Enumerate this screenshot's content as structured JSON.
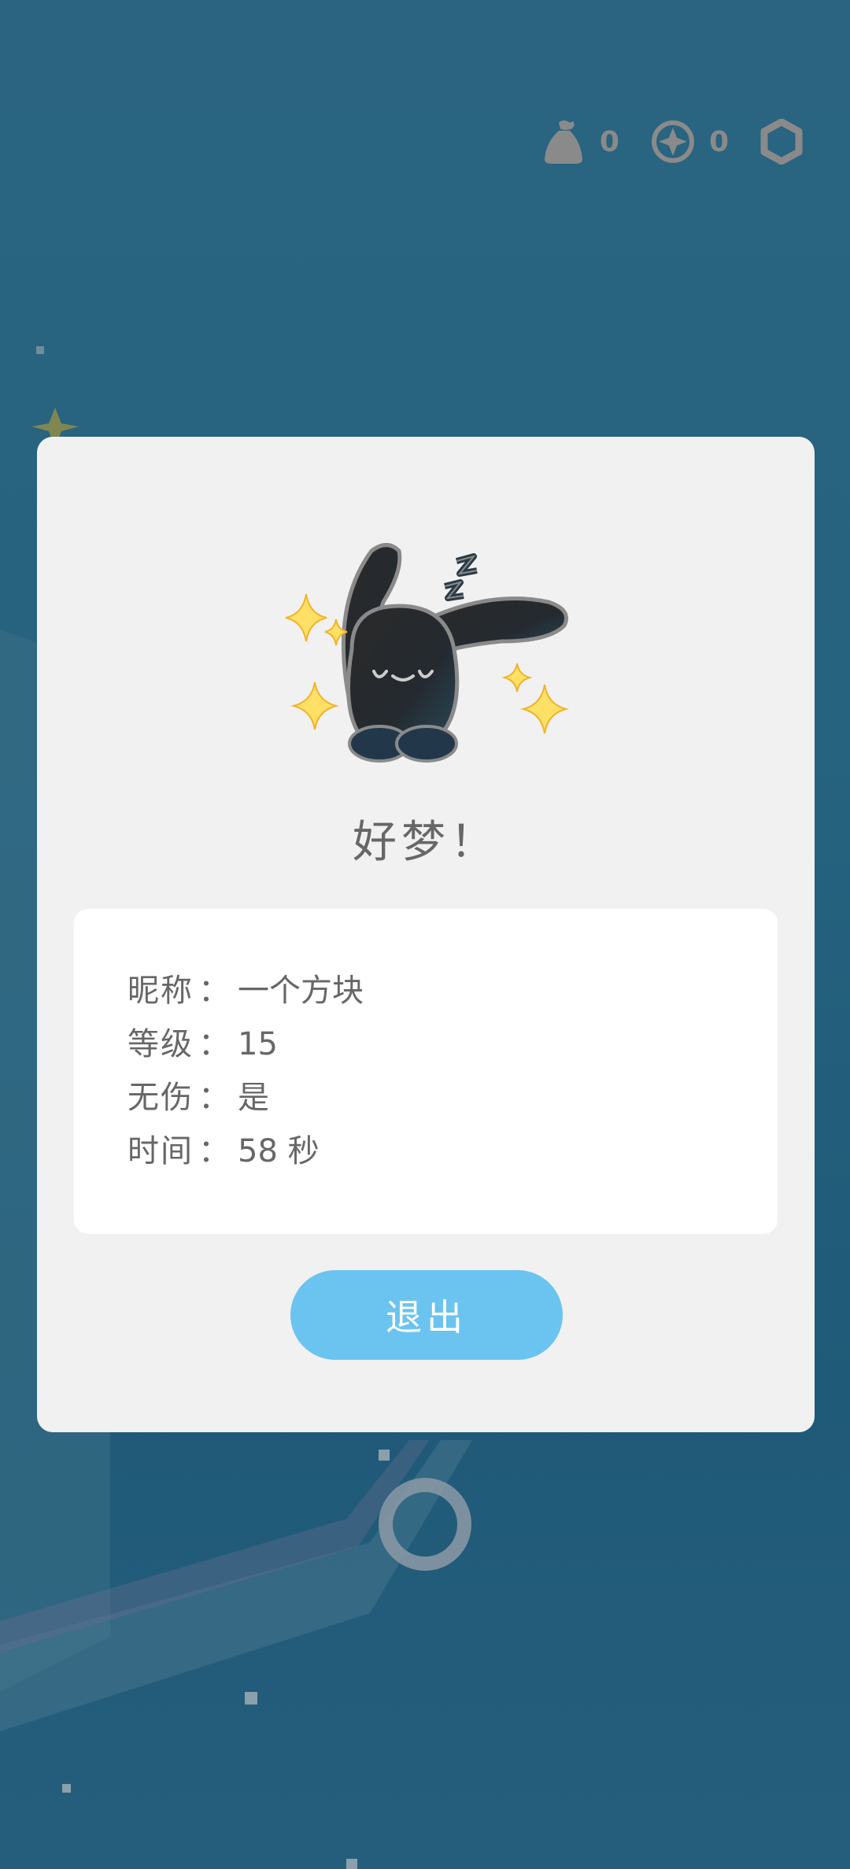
{
  "hud": {
    "bag_count": "0",
    "compass_count": "0",
    "bag_icon": "money-bag-icon",
    "compass_icon": "compass-icon",
    "settings_icon": "hexagon-settings-icon"
  },
  "dialog": {
    "title": "好梦！",
    "illustration": "sleeping-black-rabbit",
    "info": [
      {
        "label": "昵称",
        "separator": "：",
        "value": "一个方块"
      },
      {
        "label": "等级",
        "separator": "：",
        "value": "15"
      },
      {
        "label": "无伤",
        "separator": "：",
        "value": "是"
      },
      {
        "label": "时间",
        "separator": "：",
        "value": "58 秒"
      }
    ],
    "exit_label": "退出"
  },
  "colors": {
    "background": "#26637f",
    "panel": "#f1f1f1",
    "card": "#ffffff",
    "button": "#6bc4ef",
    "text": "#676767",
    "hud_icon": "#8a8a8a"
  }
}
